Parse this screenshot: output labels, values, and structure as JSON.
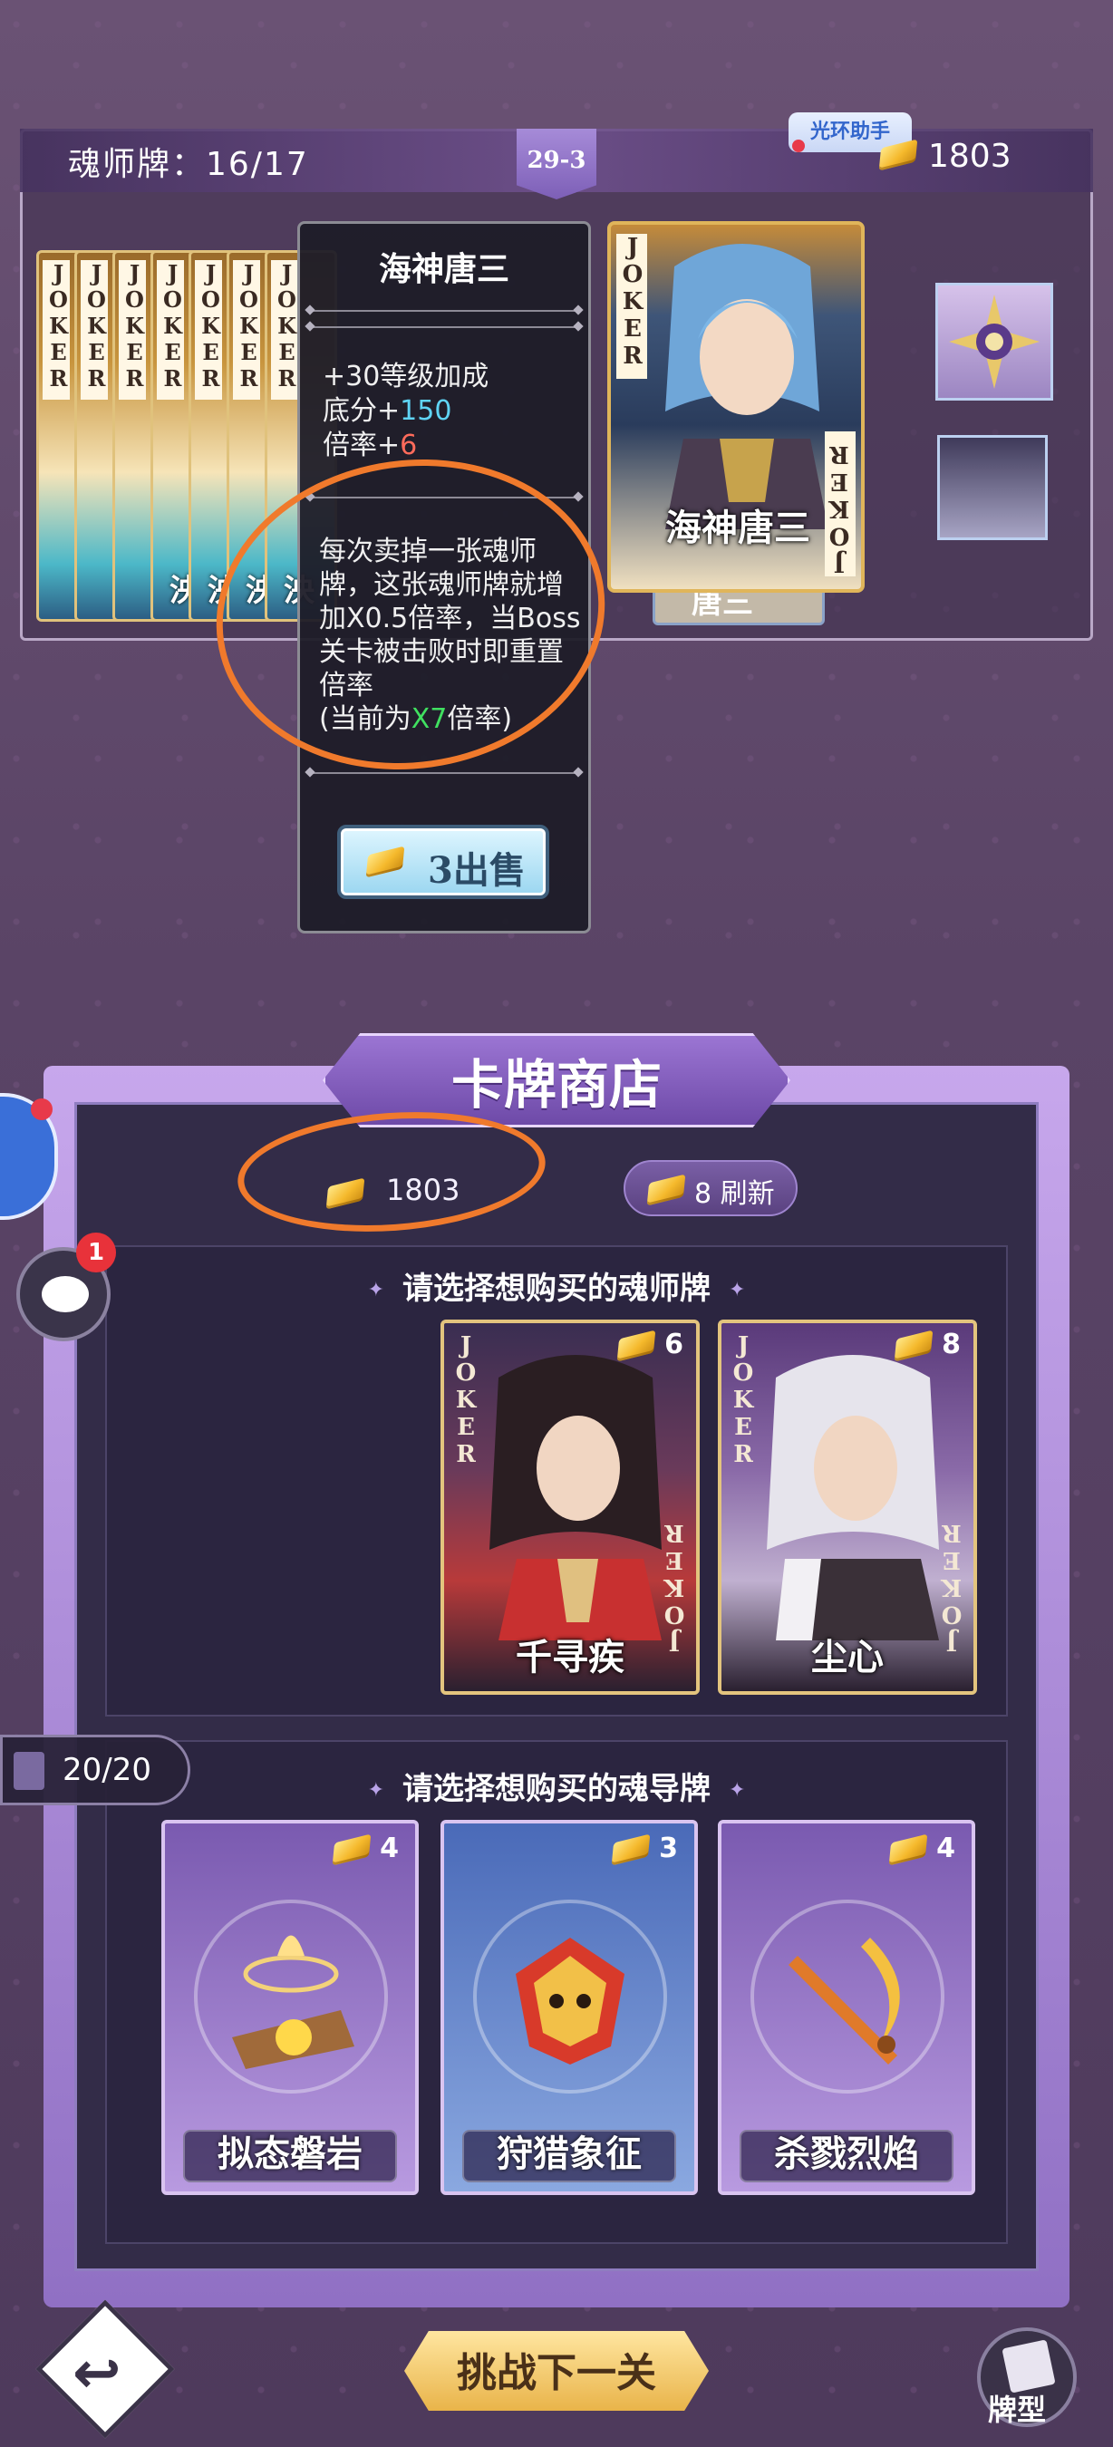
{
  "hud": {
    "hand_count": "魂师牌：16/17",
    "level": "29-3",
    "helper_badge": "光环助手",
    "gold": "1803"
  },
  "hand_cards": {
    "corner_text": "JOKER",
    "partial_names": [
      "泱",
      "泱",
      "泱",
      "泱"
    ],
    "behind_name": "唐三"
  },
  "featured_card": {
    "corner_text": "JOKER",
    "name": "海神唐三"
  },
  "tooltip": {
    "title": "海神唐三",
    "stat_level": "+30等级加成",
    "stat_base_label": "底分+",
    "stat_base_value": "150",
    "stat_mult_label": "倍率+",
    "stat_mult_value": "6",
    "desc_main": "每次卖掉一张魂师牌，这张魂师牌就增加X0.5倍率，当Boss关卡被击败时即重置倍率",
    "desc_current_prefix": "(当前为",
    "desc_current_value": "X7",
    "desc_current_suffix": "倍率)",
    "sell_label": "3出售"
  },
  "shop": {
    "title": "卡牌商店",
    "gold": "1803",
    "refresh_label": "8 刷新",
    "soul_master_heading": "请选择想购买的魂师牌",
    "soul_tool_heading": "请选择想购买的魂导牌",
    "soul_masters": [
      {
        "name": "千寻疾",
        "price": "6",
        "corner_text": "JOKER"
      },
      {
        "name": "尘心",
        "price": "8",
        "corner_text": "JOKER"
      }
    ],
    "soul_tools": [
      {
        "name": "拟态磐岩",
        "price": "4"
      },
      {
        "name": "狩猎象征",
        "price": "3"
      },
      {
        "name": "杀戮烈焰",
        "price": "4"
      }
    ]
  },
  "side": {
    "chat_badge": "1",
    "deck_counter": "20/20"
  },
  "bottom": {
    "next_label": "挑战下一关",
    "deck_type_label": "牌型"
  },
  "colors": {
    "accent_purple": "#7d5fb7",
    "gold": "#f5b92c",
    "highlight_blue": "#5fd4f4",
    "highlight_red": "#ff6b5b",
    "highlight_green": "#40e060",
    "annotation_orange": "#f07a2c"
  }
}
